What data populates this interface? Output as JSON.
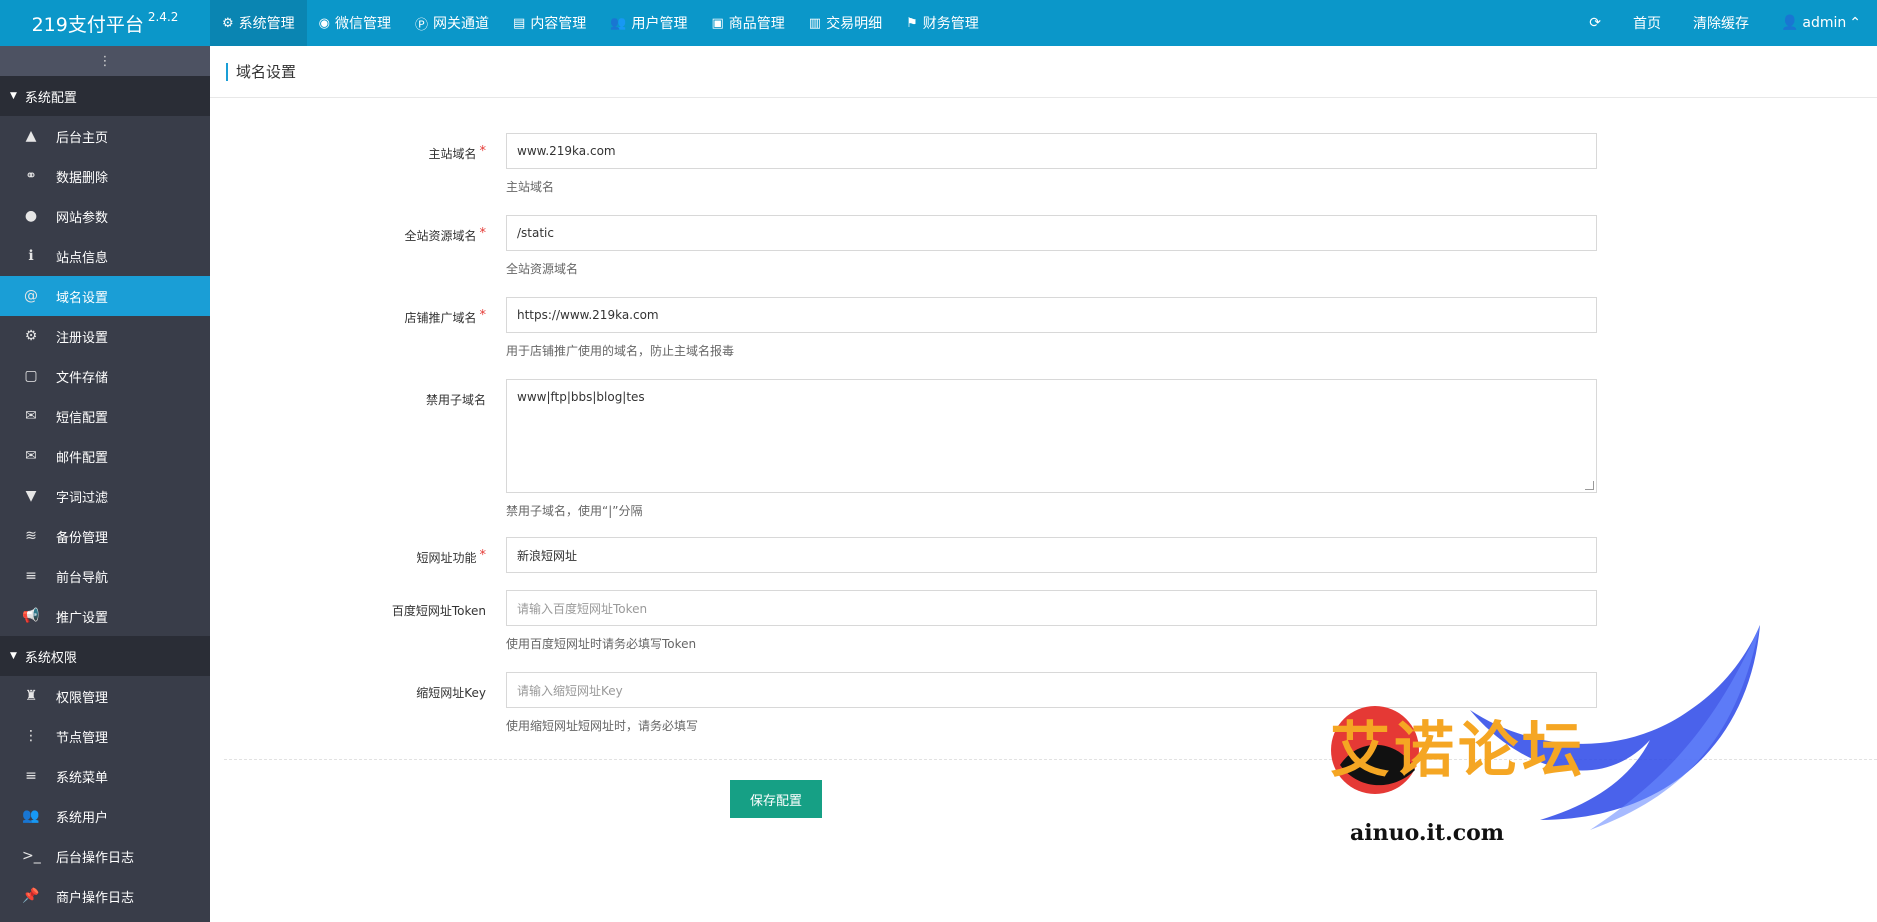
{
  "brand": {
    "name": "219支付平台",
    "version": "2.4.2"
  },
  "topnav": [
    {
      "icon": "⚙",
      "label": "系统管理",
      "active": true
    },
    {
      "icon": "◉",
      "label": "微信管理"
    },
    {
      "icon": "Ⓟ",
      "label": "网关通道"
    },
    {
      "icon": "▤",
      "label": "内容管理"
    },
    {
      "icon": "👥",
      "label": "用户管理"
    },
    {
      "icon": "▣",
      "label": "商品管理"
    },
    {
      "icon": "▥",
      "label": "交易明细"
    },
    {
      "icon": "⚑",
      "label": "财务管理"
    }
  ],
  "topright": {
    "refresh_icon": "⟳",
    "home": "首页",
    "clear_cache": "清除缓存",
    "user": "admin"
  },
  "sidebar": {
    "toggle": "⋮",
    "groups": [
      {
        "title": "系统配置",
        "items": [
          {
            "icon": "▲",
            "label": "后台主页"
          },
          {
            "icon": "⚭",
            "label": "数据删除"
          },
          {
            "icon": "●",
            "label": "网站参数"
          },
          {
            "icon": "ℹ",
            "label": "站点信息"
          },
          {
            "icon": "@",
            "label": "域名设置",
            "active": true
          },
          {
            "icon": "⚙",
            "label": "注册设置"
          },
          {
            "icon": "▢",
            "label": "文件存储"
          },
          {
            "icon": "✉",
            "label": "短信配置"
          },
          {
            "icon": "✉",
            "label": "邮件配置"
          },
          {
            "icon": "▼",
            "label": "字词过滤"
          },
          {
            "icon": "≋",
            "label": "备份管理"
          },
          {
            "icon": "≡",
            "label": "前台导航"
          },
          {
            "icon": "📢",
            "label": "推广设置"
          }
        ]
      },
      {
        "title": "系统权限",
        "items": [
          {
            "icon": "♜",
            "label": "权限管理"
          },
          {
            "icon": "⋮",
            "label": "节点管理"
          },
          {
            "icon": "≡",
            "label": "系统菜单"
          },
          {
            "icon": "👥",
            "label": "系统用户"
          },
          {
            "icon": ">_",
            "label": "后台操作日志"
          },
          {
            "icon": "📌",
            "label": "商户操作日志"
          }
        ]
      }
    ]
  },
  "page": {
    "title": "域名设置"
  },
  "form": {
    "main_domain": {
      "label": "主站域名",
      "value": "www.219ka.com",
      "help": "主站域名"
    },
    "static_domain": {
      "label": "全站资源域名",
      "value": "/static",
      "help": "全站资源域名"
    },
    "shop_domain": {
      "label": "店铺推广域名",
      "value": "https://www.219ka.com",
      "help": "用于店铺推广使用的域名，防止主域名报毒"
    },
    "banned_subdomains": {
      "label": "禁用子域名",
      "value": "www|ftp|bbs|blog|tes",
      "help": "禁用子域名，使用“|”分隔"
    },
    "short_url": {
      "label": "短网址功能",
      "value": "新浪短网址"
    },
    "baidu_token": {
      "label": "百度短网址Token",
      "placeholder": "请输入百度短网址Token",
      "help": "使用百度短网址时请务必填写Token"
    },
    "suo_key": {
      "label": "缩短网址Key",
      "placeholder": "请输入缩短网址Key",
      "help": "使用缩短网址短网址时，请务必填写"
    },
    "save": "保存配置"
  },
  "watermark": {
    "text": "艾诺论坛",
    "url": "ainuo.it.com"
  },
  "colors": {
    "topbar": "#0b97c9",
    "sidebar": "#393d49",
    "active": "#1a9ed6",
    "save": "#16a085",
    "required": "#e53935"
  }
}
